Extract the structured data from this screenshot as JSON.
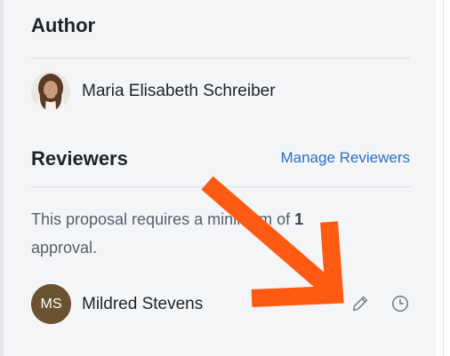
{
  "author": {
    "heading": "Author",
    "name": "Maria Elisabeth Schreiber"
  },
  "reviewers": {
    "heading": "Reviewers",
    "manage_link": "Manage Reviewers",
    "requirement_prefix": "This proposal requires a minimum of ",
    "requirement_count": "1",
    "requirement_suffix": "approval.",
    "items": [
      {
        "initials": "MS",
        "name": "Mildred Stevens",
        "avatar_color": "#6b5230"
      }
    ]
  },
  "icons": {
    "edit": "pencil-icon",
    "history": "clock-icon"
  },
  "colors": {
    "link": "#2d6fc0",
    "annotation_arrow": "#ff5a14",
    "background": "#f4f5f7"
  }
}
